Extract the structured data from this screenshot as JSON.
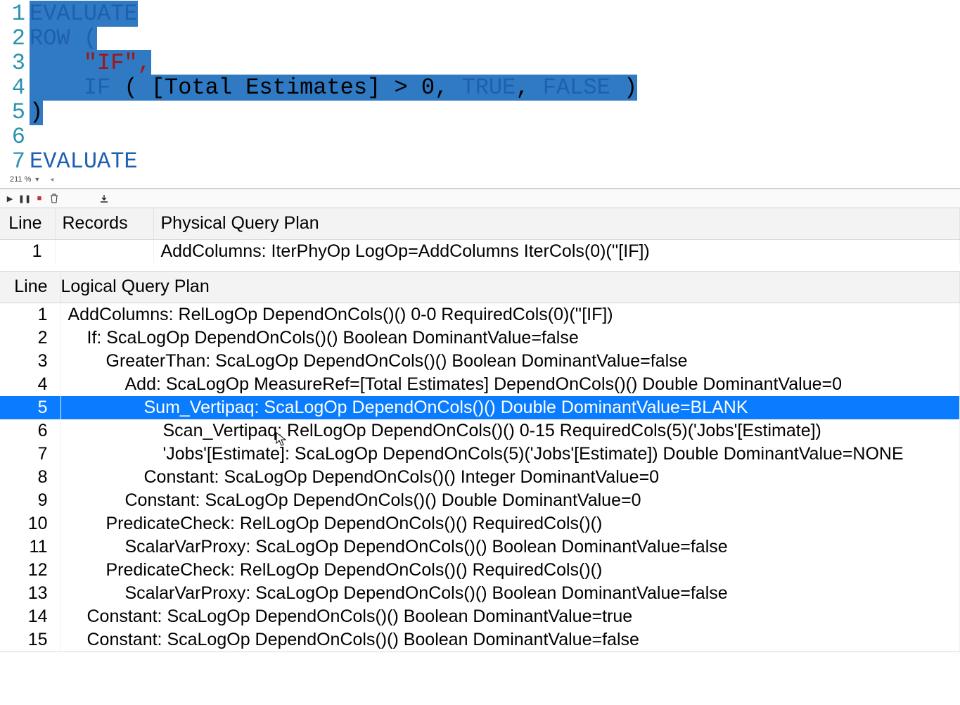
{
  "editor": {
    "zoom_label": "211 %",
    "lines": [
      {
        "n": 1,
        "segments": [
          {
            "cls": "kw sel",
            "text": "EVALUATE"
          }
        ]
      },
      {
        "n": 2,
        "segments": [
          {
            "cls": "kw sel",
            "text": "ROW ("
          }
        ]
      },
      {
        "n": 3,
        "segments": [
          {
            "cls": "pln sel",
            "text": "    "
          },
          {
            "cls": "str sel",
            "text": "\"IF\","
          }
        ]
      },
      {
        "n": 4,
        "segments": [
          {
            "cls": "pln sel",
            "text": "    "
          },
          {
            "cls": "kw sel",
            "text": "IF "
          },
          {
            "cls": "pln sel",
            "text": "( [Total Estimates] > 0, "
          },
          {
            "cls": "kw sel",
            "text": "TRUE"
          },
          {
            "cls": "pln sel",
            "text": ", "
          },
          {
            "cls": "kw sel",
            "text": "FALSE"
          },
          {
            "cls": "pln sel",
            "text": " )"
          }
        ]
      },
      {
        "n": 5,
        "segments": [
          {
            "cls": "pln sel",
            "text": ")"
          }
        ]
      },
      {
        "n": 6,
        "segments": []
      },
      {
        "n": 7,
        "segments": [
          {
            "cls": "kw",
            "text": "EVALUATE"
          }
        ]
      }
    ]
  },
  "physical_plan": {
    "headers": {
      "line": "Line",
      "records": "Records",
      "plan": "Physical Query Plan"
    },
    "rows": [
      {
        "line": 1,
        "records": "",
        "plan": "AddColumns: IterPhyOp LogOp=AddColumns IterCols(0)(''[IF])"
      }
    ]
  },
  "logical_plan": {
    "headers": {
      "line": "Line",
      "plan": "Logical Query Plan"
    },
    "selected_line": 5,
    "rows": [
      {
        "line": 1,
        "indent": 0,
        "text": "AddColumns: RelLogOp DependOnCols()() 0-0 RequiredCols(0)(''[IF])"
      },
      {
        "line": 2,
        "indent": 1,
        "text": "If: ScaLogOp DependOnCols()() Boolean DominantValue=false"
      },
      {
        "line": 3,
        "indent": 2,
        "text": "GreaterThan: ScaLogOp DependOnCols()() Boolean DominantValue=false"
      },
      {
        "line": 4,
        "indent": 3,
        "text": "Add: ScaLogOp MeasureRef=[Total Estimates] DependOnCols()() Double DominantValue=0"
      },
      {
        "line": 5,
        "indent": 4,
        "text": "Sum_Vertipaq: ScaLogOp DependOnCols()() Double DominantValue=BLANK"
      },
      {
        "line": 6,
        "indent": 5,
        "text": "Scan_Vertipaq: RelLogOp DependOnCols()() 0-15 RequiredCols(5)('Jobs'[Estimate])"
      },
      {
        "line": 7,
        "indent": 5,
        "text": "'Jobs'[Estimate]: ScaLogOp DependOnCols(5)('Jobs'[Estimate]) Double DominantValue=NONE"
      },
      {
        "line": 8,
        "indent": 4,
        "text": "Constant: ScaLogOp DependOnCols()() Integer DominantValue=0"
      },
      {
        "line": 9,
        "indent": 3,
        "text": "Constant: ScaLogOp DependOnCols()() Double DominantValue=0"
      },
      {
        "line": 10,
        "indent": 2,
        "text": "PredicateCheck: RelLogOp DependOnCols()() RequiredCols()()"
      },
      {
        "line": 11,
        "indent": 3,
        "text": "ScalarVarProxy: ScaLogOp DependOnCols()() Boolean DominantValue=false"
      },
      {
        "line": 12,
        "indent": 2,
        "text": "PredicateCheck: RelLogOp DependOnCols()() RequiredCols()()"
      },
      {
        "line": 13,
        "indent": 3,
        "text": "ScalarVarProxy: ScaLogOp DependOnCols()() Boolean DominantValue=false"
      },
      {
        "line": 14,
        "indent": 1,
        "text": "Constant: ScaLogOp DependOnCols()() Boolean DominantValue=true"
      },
      {
        "line": 15,
        "indent": 1,
        "text": "Constant: ScaLogOp DependOnCols()() Boolean DominantValue=false"
      }
    ]
  }
}
